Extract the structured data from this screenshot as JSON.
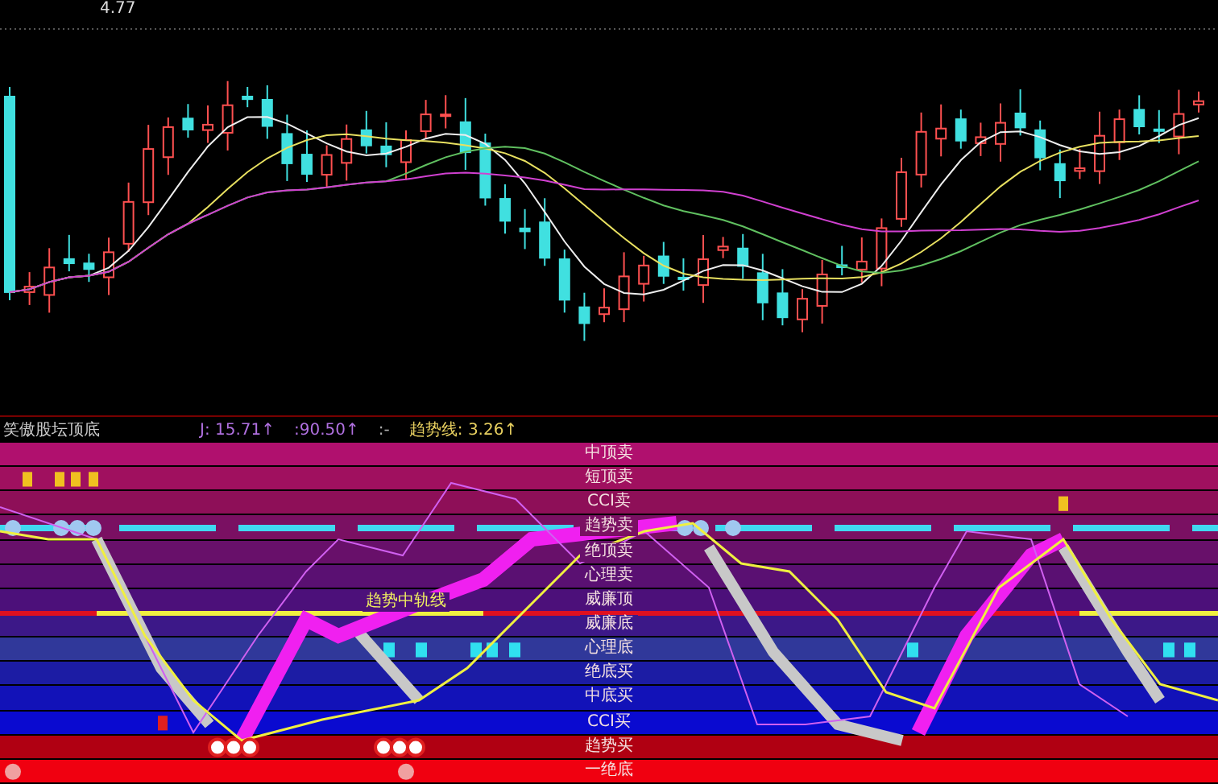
{
  "price_chart": {
    "high_label": "4.77"
  },
  "indicator": {
    "title": "笑傲股坛顶底",
    "readings": [
      {
        "text": "J: 15.71↑",
        "color": "#b070e0"
      },
      {
        "text": ":90.50↑",
        "color": "#b070e0"
      },
      {
        "text": ":-",
        "color": "#b0b0b0"
      },
      {
        "text": "趋势线: 3.26↑",
        "color": "#e8d060"
      }
    ],
    "line_label": "趋势中轨线",
    "bands": [
      {
        "label": "中顶卖",
        "color": "#b0106e"
      },
      {
        "label": "短顶卖",
        "color": "#a0105f"
      },
      {
        "label": "CCI卖",
        "color": "#8e0f58"
      },
      {
        "label": "趋势卖",
        "color": "#7a1062"
      },
      {
        "label": "绝顶卖",
        "color": "#68106a"
      },
      {
        "label": "心理卖",
        "color": "#5a1072"
      },
      {
        "label": "威廉顶",
        "color": "#4c107a"
      },
      {
        "label": "威廉底",
        "color": "#3c1888"
      },
      {
        "label": "心理底",
        "color": "#30389a"
      },
      {
        "label": "绝底买",
        "color": "#1c1ca4"
      },
      {
        "label": "中底买",
        "color": "#1212b8"
      },
      {
        "label": "CCI买",
        "color": "#0a0ad0"
      },
      {
        "label": "趋势买",
        "color": "#b00012"
      },
      {
        "label": "一绝底",
        "color": "#f00010"
      }
    ]
  }
}
